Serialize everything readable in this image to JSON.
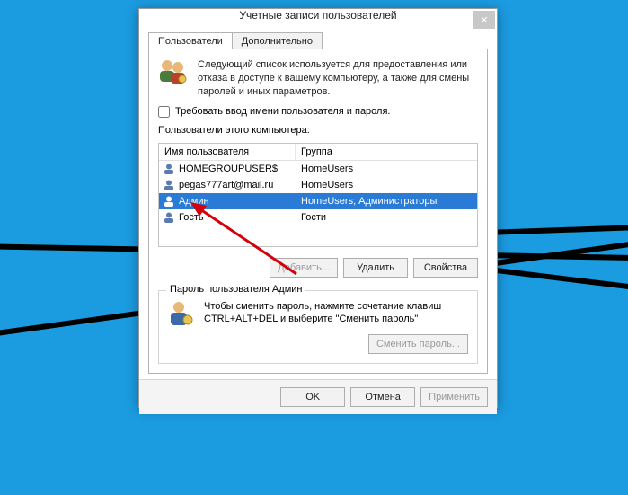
{
  "window": {
    "title": "Учетные записи пользователей"
  },
  "tabs": {
    "users": "Пользователи",
    "advanced": "Дополнительно"
  },
  "intro": "Следующий список используется для предоставления или отказа в доступе к вашему компьютеру, а также для смены паролей и иных параметров.",
  "require_login_label": "Требовать ввод имени пользователя и пароля.",
  "list_caption": "Пользователи этого компьютера:",
  "columns": {
    "user": "Имя пользователя",
    "group": "Группа"
  },
  "rows": [
    {
      "name": "HOMEGROUPUSER$",
      "group": "HomeUsers",
      "selected": false
    },
    {
      "name": "pegas777art@mail.ru",
      "group": "HomeUsers",
      "selected": false
    },
    {
      "name": "Админ",
      "group": "HomeUsers; Администраторы",
      "selected": true
    },
    {
      "name": "Гость",
      "group": "Гости",
      "selected": false
    }
  ],
  "buttons": {
    "add": "Добавить...",
    "remove": "Удалить",
    "props": "Свойства"
  },
  "password_box": {
    "title": "Пароль пользователя Админ",
    "text": "Чтобы сменить пароль, нажмите сочетание клавиш CTRL+ALT+DEL и выберите \"Сменить пароль\"",
    "button": "Сменить пароль..."
  },
  "footer": {
    "ok": "OK",
    "cancel": "Отмена",
    "apply": "Применить"
  }
}
